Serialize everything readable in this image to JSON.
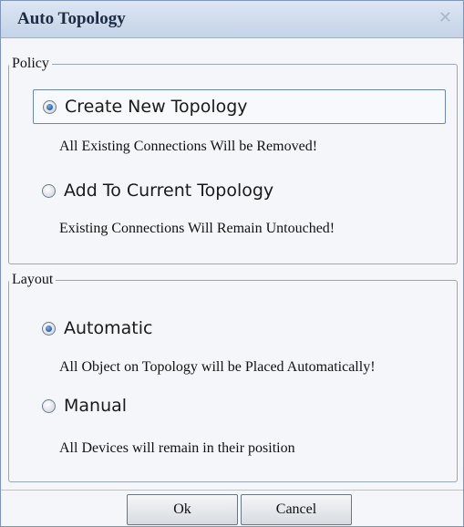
{
  "dialog": {
    "title": "Auto Topology",
    "close_icon": "close-icon"
  },
  "policy": {
    "legend": "Policy",
    "options": [
      {
        "label": "Create New Topology",
        "checked": true,
        "note": "All Existing Connections Will be Removed!"
      },
      {
        "label": "Add To Current Topology",
        "checked": false,
        "note": "Existing Connections Will Remain Untouched!"
      }
    ]
  },
  "layout": {
    "legend": "Layout",
    "options": [
      {
        "label": "Automatic",
        "checked": true,
        "note": "All Object on Topology will be Placed Automatically!"
      },
      {
        "label": "Manual",
        "checked": false,
        "note": "All Devices will remain in their position"
      }
    ]
  },
  "buttons": {
    "ok": "Ok",
    "cancel": "Cancel"
  }
}
